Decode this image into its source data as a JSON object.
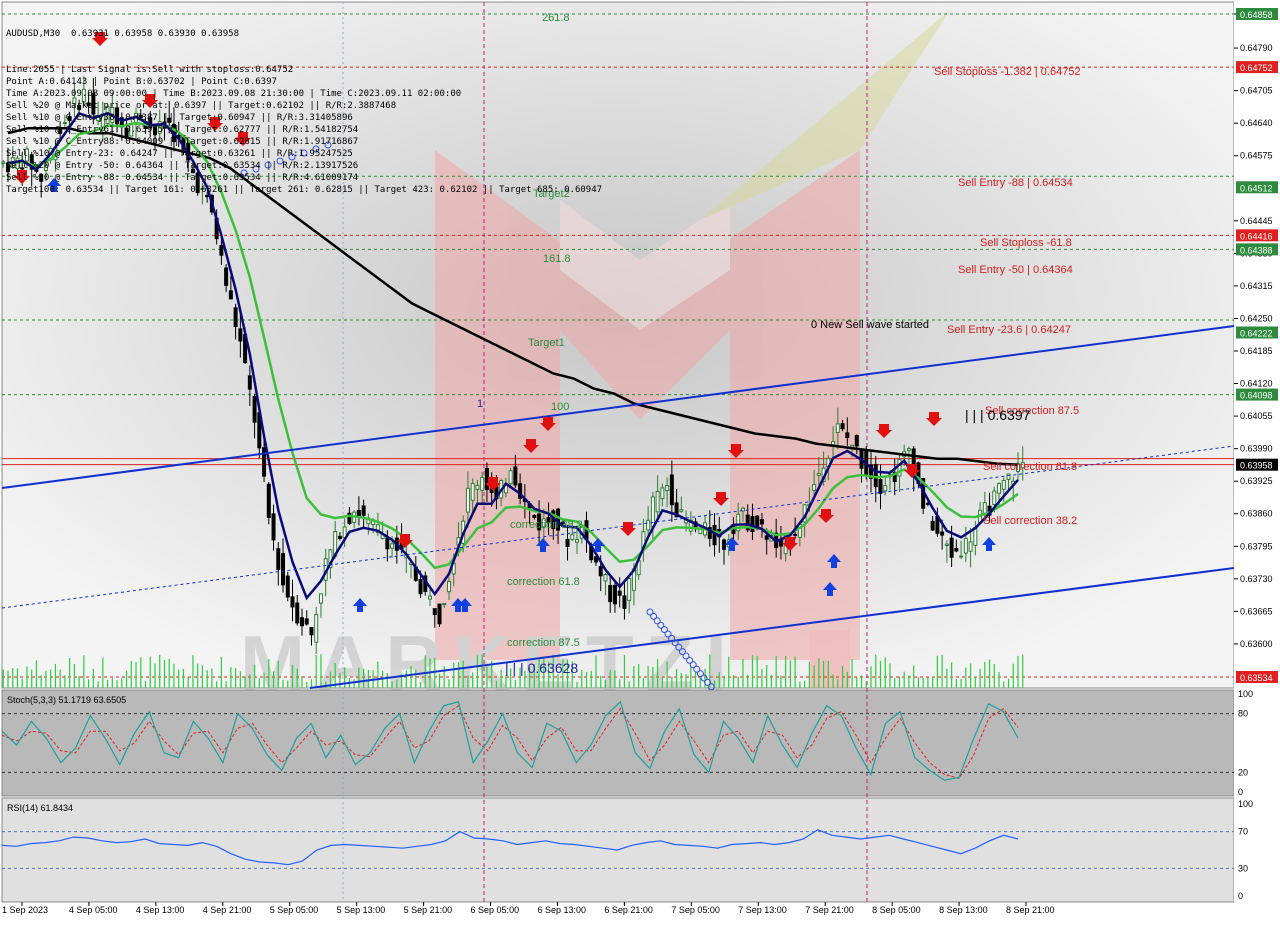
{
  "symbol_line": "AUDUSD,M30  0.63931 0.63958 0.63930 0.63958",
  "info_lines": [
    "Line:2055 | Last Signal is:Sell with stoploss:0.64752",
    "Point A:0.64143 | Point B:0.63702 | Point C:0.6397",
    "Time A:2023.09.08 09:00:00 | Time B:2023.09.08 21:30:00 | Time C:2023.09.11 02:00:00",
    "Sell %20 @ Market price or at: 0.6397 || Target:0.62102 || R/R:2.3887468",
    "Sell %10 @ C_Entry38: 0.6387 || Target:0.60947 || R/R:3.31405896",
    "Sell %10 @ C_Entry61: 0.63975 || Target:0.62777 || R/R:1.54182754",
    "Sell %10 @ C_Entry88: 0.64009 || Target:0.62815 || R/R:1.91716867",
    "Sell %10 @ Entry-23: 0.64247 || Target:0.63261 || R/R:1.95247525",
    "Sell %20 @ Entry -50: 0.64364 || Target:0.63534 || R/R:2.13917526",
    "Sell %20 @ Entry -88: 0.64534 || Target:0.63534 || R/R:4.61009174",
    "Target100: 0.63534 || Target 161: 0.63261 || Target 261: 0.62815 || Target 423: 0.62102 || Target 685: 0.60947"
  ],
  "colors": {
    "background": "#ffffff",
    "bull": "#2e7d32",
    "bear": "#000000",
    "ma_black": "#000000",
    "ma_green": "#3cc03c",
    "ma_navy": "#0a0a78",
    "channel": "#1030d0",
    "sell_level": "#e02020",
    "green_level": "#2e8b3e",
    "vertical_marker": "#c0207c",
    "stoch_main": "#20a0a0",
    "stoch_signal": "#e02020",
    "rsi": "#2060ff",
    "volume": "#2ecc40"
  },
  "main_labels": [
    {
      "text": "261.8",
      "color": "#2e8b3e"
    },
    {
      "text": "Target2",
      "color": "#2e8b3e"
    },
    {
      "text": "161.8",
      "color": "#2e8b3e"
    },
    {
      "text": "Target1",
      "color": "#2e8b3e"
    },
    {
      "text": "100",
      "color": "#2e8b3e"
    },
    {
      "text": "1",
      "color": "#2020a0"
    },
    {
      "text": "Sell Stoploss -1.382 | 0.64752",
      "color": "#d02020"
    },
    {
      "text": "Sell Entry -88 | 0.64534",
      "color": "#d02020"
    },
    {
      "text": "Sell Stoploss -61.8",
      "color": "#d02020"
    },
    {
      "text": "Sell Entry -50 | 0.64364",
      "color": "#d02020"
    },
    {
      "text": "0 New Sell wave started",
      "color": "#000000"
    },
    {
      "text": "Sell Entry -23.6 | 0.64247",
      "color": "#d02020"
    },
    {
      "text": "Sell correction 87.5",
      "color": "#d02020"
    },
    {
      "text": "| | | 0.6397",
      "color": "#000000"
    },
    {
      "text": "Sell correction 61.8",
      "color": "#d02020"
    },
    {
      "text": "Sell correction 38.2",
      "color": "#d02020"
    },
    {
      "text": "correction 38.2",
      "color": "#2e8b3e"
    },
    {
      "text": "correction 61.8",
      "color": "#2e8b3e"
    },
    {
      "text": "correction 87.5",
      "color": "#2e8b3e"
    },
    {
      "text": "| | | 0.63628",
      "color": "#2020a0"
    }
  ],
  "chart_data": {
    "type": "candlestick",
    "price_axis": {
      "ylim": [
        0.6352,
        0.6487
      ],
      "ticks": [
        "0.64858",
        "0.64790",
        "0.64705",
        "0.64640",
        "0.64575",
        "0.64445",
        "0.64380",
        "0.64315",
        "0.64250",
        "0.64185",
        "0.64120",
        "0.64055",
        "0.63990",
        "0.63925",
        "0.63860",
        "0.63795",
        "0.63730",
        "0.63665",
        "0.63600"
      ],
      "highlight_labels": [
        {
          "value": "0.64858",
          "color": "#2e8b3e"
        },
        {
          "value": "0.64752",
          "color": "#e02020"
        },
        {
          "value": "0.64512",
          "color": "#2e8b3e"
        },
        {
          "value": "0.64416",
          "color": "#e02020"
        },
        {
          "value": "0.64388",
          "color": "#2e8b3e"
        },
        {
          "value": "0.64222",
          "color": "#2e8b3e"
        },
        {
          "value": "0.64098",
          "color": "#2e8b3e"
        },
        {
          "value": "0.63958",
          "color": "#000000"
        },
        {
          "value": "0.63534",
          "color": "#e02020"
        }
      ]
    },
    "horizontal_levels": [
      {
        "value": 0.64858,
        "color": "#2e8b3e",
        "style": "dashed"
      },
      {
        "value": 0.64752,
        "color": "#e02020",
        "style": "dashed"
      },
      {
        "value": 0.64534,
        "color": "#2e8b3e",
        "style": "dashed"
      },
      {
        "value": 0.64416,
        "color": "#e02020",
        "style": "dashed"
      },
      {
        "value": 0.64388,
        "color": "#2e8b3e",
        "style": "dashed"
      },
      {
        "value": 0.64247,
        "color": "#2e8b3e",
        "style": "dashed"
      },
      {
        "value": 0.64098,
        "color": "#2e8b3e",
        "style": "dashed"
      },
      {
        "value": 0.6397,
        "color": "#e02020",
        "style": "solid"
      },
      {
        "value": 0.63958,
        "color": "#e02020",
        "style": "solid"
      },
      {
        "value": 0.63534,
        "color": "#e02020",
        "style": "dashed"
      }
    ],
    "time_labels": [
      "1 Sep 2023",
      "4 Sep 05:00",
      "4 Sep 13:00",
      "4 Sep 21:00",
      "5 Sep 05:00",
      "5 Sep 13:00",
      "5 Sep 21:00",
      "6 Sep 05:00",
      "6 Sep 13:00",
      "6 Sep 21:00",
      "7 Sep 05:00",
      "7 Sep 13:00",
      "7 Sep 21:00",
      "8 Sep 05:00",
      "8 Sep 13:00",
      "8 Sep 21:00"
    ],
    "close_path": [
      0.6456,
      0.6457,
      0.6453,
      0.6461,
      0.6466,
      0.647,
      0.6464,
      0.6467,
      0.6463,
      0.6466,
      0.6462,
      0.6464,
      0.6458,
      0.6452,
      0.6446,
      0.6432,
      0.642,
      0.6405,
      0.6385,
      0.6372,
      0.6366,
      0.6362,
      0.6376,
      0.6383,
      0.6387,
      0.6384,
      0.6382,
      0.6379,
      0.6375,
      0.637,
      0.6366,
      0.6378,
      0.639,
      0.6394,
      0.6388,
      0.6396,
      0.6388,
      0.6384,
      0.6385,
      0.6381,
      0.6383,
      0.6376,
      0.637,
      0.6368,
      0.6378,
      0.6388,
      0.6392,
      0.6385,
      0.6383,
      0.6382,
      0.638,
      0.6386,
      0.6384,
      0.6382,
      0.6378,
      0.6383,
      0.6389,
      0.6397,
      0.6403,
      0.64,
      0.6395,
      0.6392,
      0.6394,
      0.6399,
      0.6388,
      0.6382,
      0.6378,
      0.638,
      0.6385,
      0.6389,
      0.6393,
      0.6396
    ],
    "stochastic": {
      "label": "Stoch(5,3,3) 51.1719 63.6505",
      "levels": [
        "80",
        "20"
      ],
      "main": [
        62,
        48,
        72,
        55,
        30,
        45,
        78,
        55,
        28,
        60,
        82,
        40,
        35,
        72,
        55,
        30,
        80,
        65,
        38,
        22,
        55,
        70,
        35,
        58,
        28,
        40,
        65,
        80,
        30,
        62,
        88,
        92,
        30,
        52,
        80,
        40,
        25,
        70,
        62,
        30,
        48,
        78,
        92,
        40,
        24,
        62,
        85,
        38,
        20,
        72,
        55,
        30,
        78,
        48,
        25,
        60,
        88,
        78,
        45,
        18,
        70,
        82,
        35,
        22,
        12,
        15,
        55,
        90,
        82,
        55
      ],
      "signal": [
        58,
        52,
        62,
        60,
        42,
        40,
        62,
        62,
        42,
        50,
        72,
        52,
        38,
        60,
        62,
        40,
        65,
        70,
        48,
        30,
        45,
        62,
        48,
        52,
        38,
        36,
        55,
        72,
        45,
        52,
        78,
        88,
        55,
        42,
        68,
        55,
        32,
        55,
        66,
        42,
        42,
        65,
        85,
        60,
        32,
        48,
        72,
        52,
        30,
        58,
        62,
        40,
        62,
        58,
        35,
        48,
        75,
        82,
        58,
        30,
        55,
        75,
        50,
        30,
        18,
        14,
        38,
        75,
        85,
        66
      ]
    },
    "rsi": {
      "label": "RSI(14) 61.8434",
      "levels": [
        "70",
        "30"
      ],
      "axis_ticks": [
        "100",
        "70",
        "30",
        "0"
      ],
      "values": [
        55,
        54,
        57,
        58,
        60,
        64,
        63,
        60,
        58,
        59,
        62,
        57,
        56,
        55,
        58,
        54,
        46,
        40,
        37,
        36,
        34,
        38,
        50,
        55,
        56,
        55,
        54,
        53,
        52,
        54,
        56,
        60,
        70,
        63,
        62,
        60,
        56,
        58,
        60,
        57,
        56,
        54,
        52,
        50,
        55,
        58,
        60,
        56,
        55,
        54,
        52,
        56,
        57,
        58,
        56,
        58,
        62,
        72,
        66,
        64,
        62,
        64,
        66,
        62,
        58,
        54,
        50,
        46,
        52,
        60,
        66,
        62
      ]
    },
    "stoch_axis_ticks": [
      "100",
      "80",
      "20",
      "0"
    ]
  }
}
